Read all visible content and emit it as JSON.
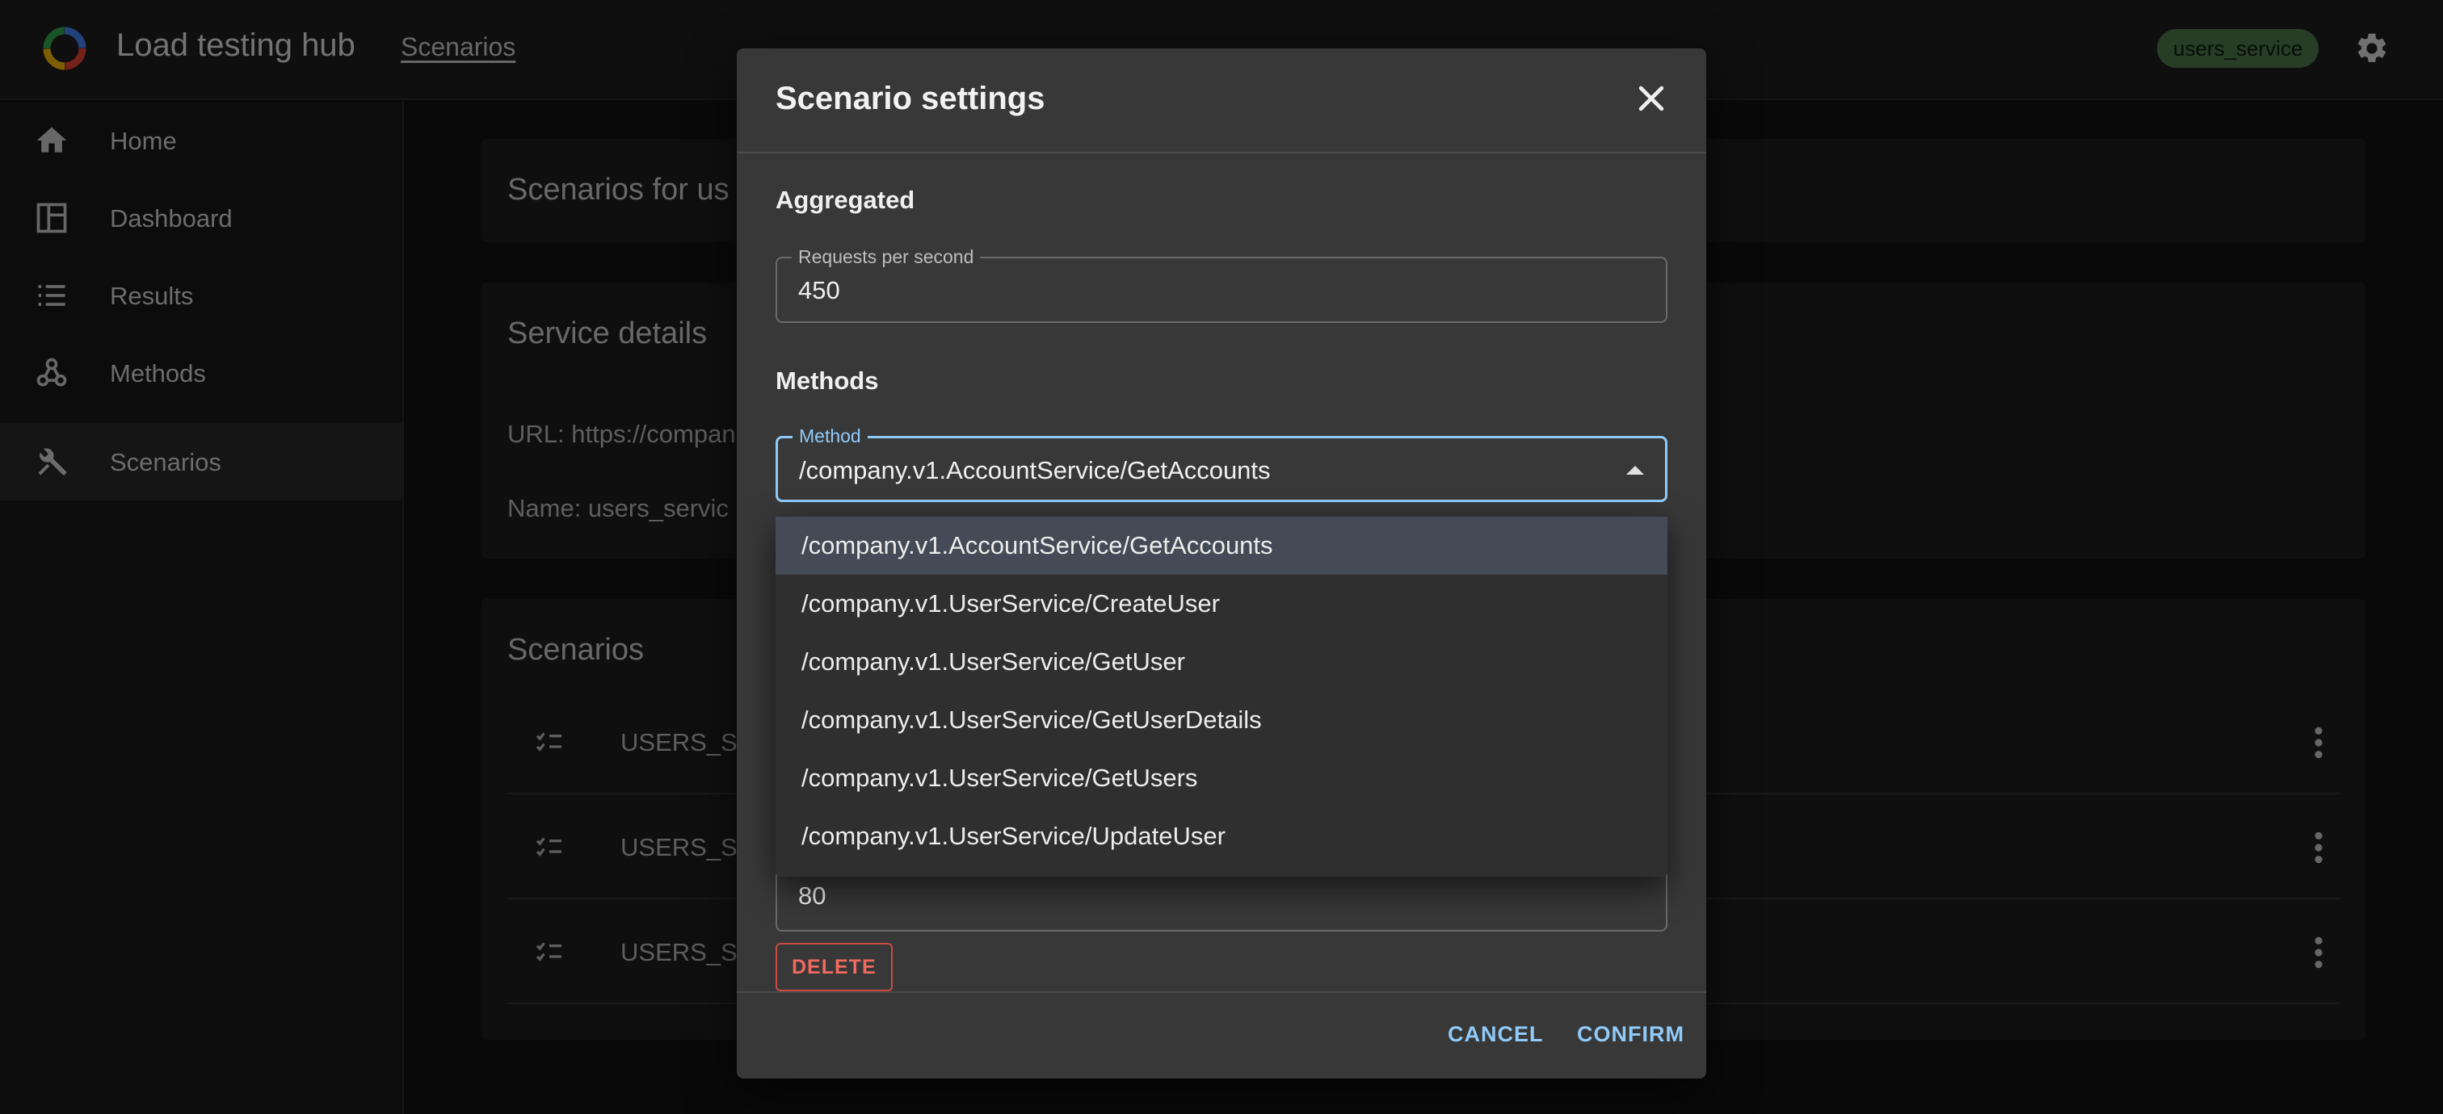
{
  "app": {
    "title": "Load testing hub",
    "breadcrumb": "Scenarios",
    "service_chip": "users_service"
  },
  "sidebar": {
    "items": [
      {
        "label": "Home",
        "icon": "home-icon"
      },
      {
        "label": "Dashboard",
        "icon": "dashboard-icon"
      },
      {
        "label": "Results",
        "icon": "list-icon"
      },
      {
        "label": "Methods",
        "icon": "webhook-icon"
      },
      {
        "label": "Scenarios",
        "icon": "tools-icon",
        "active": true
      }
    ]
  },
  "main": {
    "scenarios_for_title": "Scenarios for us",
    "service_details_title": "Service details",
    "url_text": "URL: https://compan",
    "name_text": "Name: users_servic",
    "scenarios_title": "Scenarios",
    "rows": [
      {
        "label": "USERS_SE"
      },
      {
        "label": "USERS_SE"
      },
      {
        "label": "USERS_SE"
      }
    ]
  },
  "dialog": {
    "title": "Scenario settings",
    "aggregated_heading": "Aggregated",
    "rps_label": "Requests per second",
    "rps_value": "450",
    "methods_heading": "Methods",
    "method_label": "Method",
    "method_value": "/company.v1.AccountService/GetAccounts",
    "hidden_field_value": "80",
    "delete_label": "DELETE",
    "cancel_label": "CANCEL",
    "confirm_label": "CONFIRM"
  },
  "menu": {
    "options": [
      "/company.v1.AccountService/GetAccounts",
      "/company.v1.UserService/CreateUser",
      "/company.v1.UserService/GetUser",
      "/company.v1.UserService/GetUserDetails",
      "/company.v1.UserService/GetUsers",
      "/company.v1.UserService/UpdateUser"
    ],
    "selected_index": 0
  },
  "colors": {
    "accent": "#90caf9",
    "chip_bg": "#4e7a4b",
    "danger": "#f06a60",
    "dialog_bg": "#383838"
  }
}
